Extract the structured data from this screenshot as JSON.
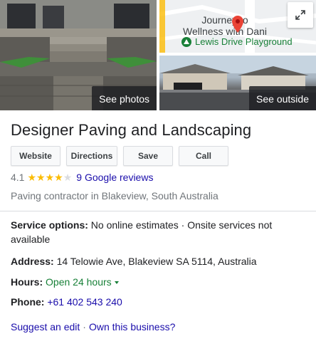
{
  "gallery": {
    "see_photos_label": "See photos",
    "see_outside_label": "See outside",
    "map": {
      "poi_label_line1": "Journey to",
      "poi_label_line2": "Wellness with Dani",
      "playground_label": "Lewis Drive Playground",
      "pin_color": "#ea4335",
      "playground_color": "#188038"
    }
  },
  "place": {
    "title": "Designer Paving and Landscaping"
  },
  "actions": {
    "website_label": "Website",
    "directions_label": "Directions",
    "save_label": "Save",
    "call_label": "Call"
  },
  "rating": {
    "value": "4.1",
    "stars_filled": 4,
    "stars_total": 5,
    "reviews_text": "9 Google reviews"
  },
  "category": "Paving contractor in Blakeview, South Australia",
  "details": {
    "service_label": "Service options:",
    "service_value": " No online estimates · Onsite services not available",
    "address_label": "Address:",
    "address_value": " 14 Telowie Ave, Blakeview SA 5114, Australia",
    "hours_label": "Hours:",
    "hours_value": "Open 24 hours",
    "phone_label": "Phone:",
    "phone_value": "+61 402 543 240"
  },
  "links": {
    "suggest_edit": "Suggest an edit",
    "separator": "·",
    "own_business": "Own this business?"
  },
  "colors": {
    "link_blue": "#1a0dab",
    "open_green": "#188038",
    "star_yellow": "#fbbc04",
    "muted_gray": "#70757a"
  }
}
